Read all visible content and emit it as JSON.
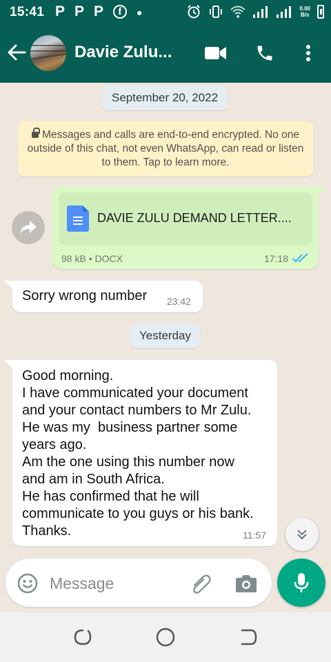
{
  "status_bar": {
    "time": "15:41",
    "notification_letters": [
      "P",
      "P",
      "P"
    ],
    "net_speed_value": "0.00",
    "net_speed_unit": "B/s"
  },
  "header": {
    "contact_name": "Davie Zulu...",
    "color": "#075e54"
  },
  "chat": {
    "date_1": "September 20, 2022",
    "encryption_notice": "Messages and calls are end-to-end encrypted. No one outside of this chat, not even WhatsApp, can read or listen to them. Tap to learn more.",
    "messages": [
      {
        "direction": "outgoing",
        "type": "document",
        "doc_name": "DAVIE ZULU DEMAND LETTER....",
        "doc_meta": "98 kB • DOCX",
        "time": "17:18",
        "status": "read"
      },
      {
        "direction": "incoming",
        "text": "Sorry wrong number",
        "time": "23:42"
      }
    ],
    "date_2": "Yesterday",
    "messages_2": [
      {
        "direction": "incoming",
        "text": "Good morning.\nI have communicated your document\nand your contact numbers to Mr Zulu.\nHe was my  business partner some\nyears ago.\nAm the one using this number now\nand am in South Africa.\nHe has confirmed that he will\ncommunicate to you guys or his bank.\nThanks.",
        "time": "11:57"
      }
    ]
  },
  "composer": {
    "placeholder": "Message"
  },
  "colors": {
    "outgoing_bubble": "#dcf8c6",
    "incoming_bubble": "#ffffff",
    "accent": "#00a884",
    "read_ticks": "#34b7f1"
  }
}
